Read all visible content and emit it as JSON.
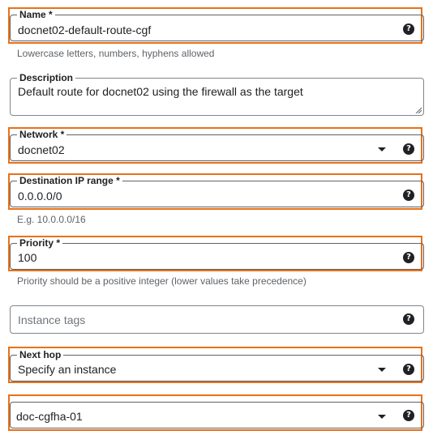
{
  "name": {
    "label": "Name *",
    "value": "docnet02-default-route-cgf",
    "help": "Lowercase letters, numbers, hyphens allowed"
  },
  "description": {
    "label": "Description",
    "value": "Default route for docnet02 using the firewall as the target"
  },
  "network": {
    "label": "Network *",
    "value": "docnet02"
  },
  "destination": {
    "label": "Destination IP range *",
    "value": "0.0.0.0/0",
    "help": "E.g. 10.0.0.0/16"
  },
  "priority": {
    "label": "Priority *",
    "value": "100",
    "help": "Priority should be a positive integer (lower values take precedence)"
  },
  "instance_tags": {
    "placeholder": "Instance tags"
  },
  "next_hop": {
    "label": "Next hop",
    "value": "Specify an instance"
  },
  "instance": {
    "value": "doc-cgfha-01"
  },
  "icons": {
    "help": "?",
    "dropdown": "chevron-down-icon"
  },
  "colors": {
    "highlight": "#e8711a",
    "border": "#80868b",
    "text": "#202124",
    "helper_text": "#5f6368"
  }
}
